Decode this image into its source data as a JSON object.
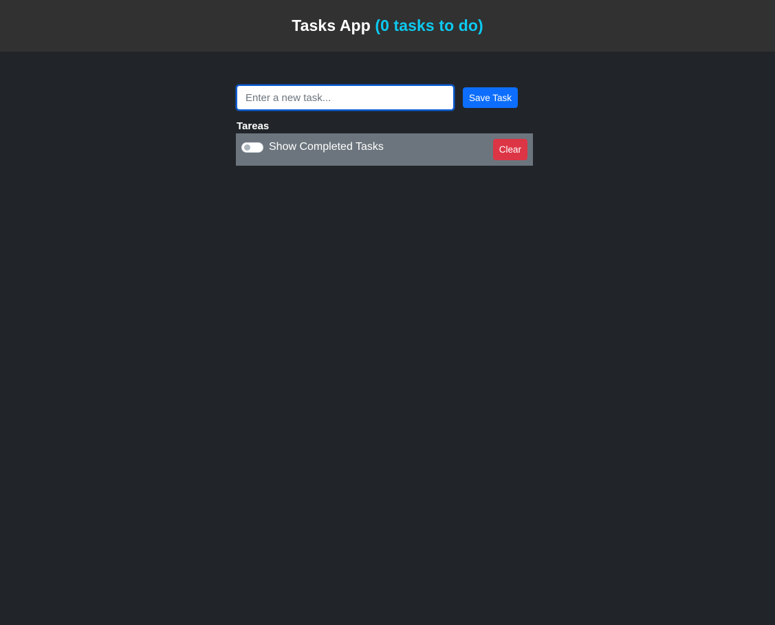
{
  "header": {
    "title": "Tasks App",
    "count_text": "(0 tasks to do)"
  },
  "form": {
    "input_placeholder": "Enter a new task...",
    "input_value": "",
    "save_label": "Save Task"
  },
  "tasks_section": {
    "title": "Tareas",
    "toggle_label": "Show Completed Tasks",
    "toggle_on": false,
    "clear_label": "Clear"
  },
  "colors": {
    "background": "#212529",
    "header_bg": "#313131",
    "accent_info": "#0dcaf0",
    "primary": "#0d6efd",
    "danger": "#dc3545",
    "secondary": "#6c757d"
  }
}
